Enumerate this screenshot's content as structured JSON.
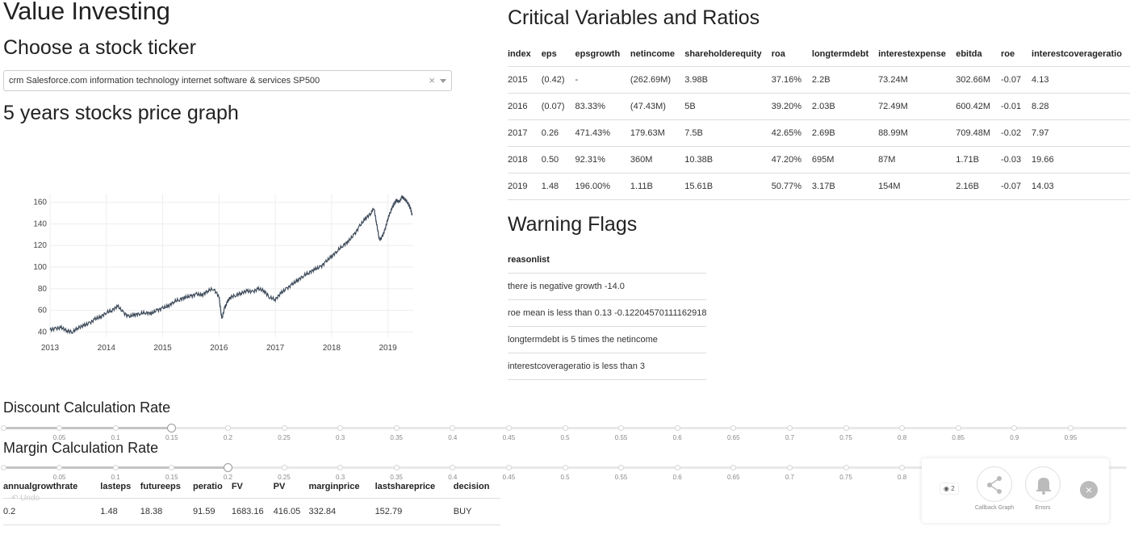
{
  "title": "Value Investing",
  "ticker_heading": "Choose a stock ticker",
  "ticker_value": "crm Salesforce.com information technology internet software & services SP500",
  "graph_heading": "5 years stocks price graph",
  "ratios_heading": "Critical Variables and Ratios",
  "flags_heading": "Warning Flags",
  "discount_heading": "Discount Calculation Rate",
  "margin_heading": "Margin Calculation Rate",
  "ratios": {
    "columns": [
      "index",
      "eps",
      "epsgrowth",
      "netincome",
      "shareholderequity",
      "roa",
      "longtermdebt",
      "interestexpense",
      "ebitda",
      "roe",
      "interestcoverageratio"
    ],
    "rows": [
      [
        "2015",
        "(0.42)",
        "-",
        "(262.69M)",
        "3.98B",
        "37.16%",
        "2.2B",
        "73.24M",
        "302.66M",
        "-0.07",
        "4.13"
      ],
      [
        "2016",
        "(0.07)",
        "83.33%",
        "(47.43M)",
        "5B",
        "39.20%",
        "2.03B",
        "72.49M",
        "600.42M",
        "-0.01",
        "8.28"
      ],
      [
        "2017",
        "0.26",
        "471.43%",
        "179.63M",
        "7.5B",
        "42.65%",
        "2.69B",
        "88.99M",
        "709.48M",
        "-0.02",
        "7.97"
      ],
      [
        "2018",
        "0.50",
        "92.31%",
        "360M",
        "10.38B",
        "47.20%",
        "695M",
        "87M",
        "1.71B",
        "-0.03",
        "19.66"
      ],
      [
        "2019",
        "1.48",
        "196.00%",
        "1.11B",
        "15.61B",
        "50.77%",
        "3.17B",
        "154M",
        "2.16B",
        "-0.07",
        "14.03"
      ]
    ]
  },
  "flags": {
    "column": "reasonlist",
    "rows": [
      "there is negative growth -14.0",
      "roe mean is less than 0.13 -0.12204570111162918",
      "longtermdebt is 5 times the netincome",
      "interestcoverageratio is less than 3"
    ]
  },
  "result": {
    "columns": [
      "annualgrowthrate",
      "lasteps",
      "futureeps",
      "peratio",
      "FV",
      "PV",
      "marginprice",
      "lastshareprice",
      "decision"
    ],
    "rows": [
      [
        "0.2",
        "1.48",
        "18.38",
        "91.59",
        "1683.16",
        "416.05",
        "332.84",
        "152.79",
        "BUY"
      ]
    ]
  },
  "sliders": {
    "marks": [
      "0.05",
      "0.1",
      "0.15",
      "0.2",
      "0.25",
      "0.3",
      "0.35",
      "0.4",
      "0.45",
      "0.5",
      "0.55",
      "0.6",
      "0.65",
      "0.7",
      "0.75",
      "0.8",
      "0.85",
      "0.9",
      "0.95"
    ],
    "discount_value": 0.15,
    "margin_value": 0.2
  },
  "debug": {
    "badge": "2",
    "callback_label": "Callback Graph",
    "errors_label": "Errors",
    "undo_label": "Undo"
  },
  "chart_data": {
    "type": "line",
    "title": "",
    "xlabel": "",
    "ylabel": "",
    "x_ticks": [
      "2013",
      "2014",
      "2015",
      "2016",
      "2017",
      "2018",
      "2019"
    ],
    "y_ticks": [
      40,
      60,
      80,
      100,
      120,
      140,
      160
    ],
    "xlim": [
      2013.0,
      2019.45
    ],
    "ylim": [
      35,
      168
    ],
    "line_color": "#3d4a5a",
    "series": [
      {
        "x": [
          2013.0,
          2013.1,
          2013.2,
          2013.3,
          2013.4,
          2013.5,
          2013.6,
          2013.7,
          2013.8,
          2013.9,
          2014.0,
          2014.1,
          2014.2,
          2014.3,
          2014.4,
          2014.5,
          2014.6,
          2014.7,
          2014.8,
          2014.9,
          2015.0,
          2015.1,
          2015.2,
          2015.3,
          2015.4,
          2015.5,
          2015.6,
          2015.7,
          2015.8,
          2015.9,
          2016.0,
          2016.05,
          2016.1,
          2016.15,
          2016.2,
          2016.3,
          2016.4,
          2016.5,
          2016.6,
          2016.7,
          2016.8,
          2016.9,
          2017.0,
          2017.1,
          2017.2,
          2017.3,
          2017.4,
          2017.5,
          2017.6,
          2017.7,
          2017.8,
          2017.9,
          2018.0,
          2018.1,
          2018.2,
          2018.3,
          2018.4,
          2018.5,
          2018.6,
          2018.7,
          2018.75,
          2018.8,
          2018.85,
          2018.9,
          2018.95,
          2019.0,
          2019.05,
          2019.1,
          2019.15,
          2019.2,
          2019.25,
          2019.3,
          2019.35,
          2019.4,
          2019.43
        ],
        "y": [
          42,
          43,
          44,
          41,
          40,
          44,
          46,
          48,
          52,
          54,
          58,
          60,
          64,
          58,
          54,
          56,
          57,
          58,
          57,
          60,
          62,
          64,
          68,
          70,
          72,
          73,
          75,
          74,
          78,
          80,
          73,
          52,
          62,
          68,
          72,
          74,
          76,
          78,
          77,
          80,
          78,
          72,
          70,
          76,
          80,
          84,
          88,
          92,
          95,
          98,
          100,
          105,
          110,
          115,
          120,
          124,
          130,
          138,
          145,
          150,
          155,
          140,
          125,
          128,
          135,
          145,
          152,
          158,
          162,
          160,
          165,
          163,
          160,
          155,
          148
        ]
      }
    ]
  }
}
